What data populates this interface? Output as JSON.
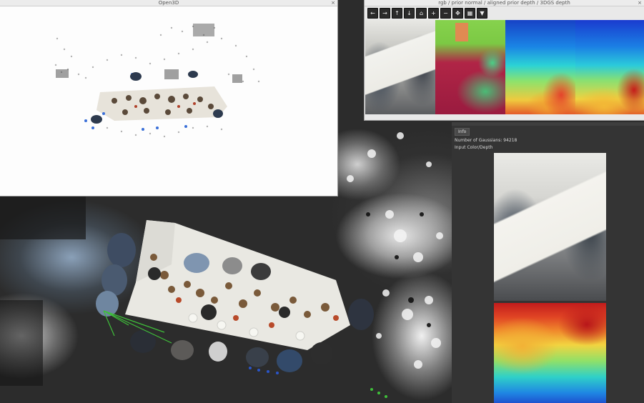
{
  "open3d_window": {
    "title": "Open3D",
    "close_glyph": "×"
  },
  "image_window": {
    "title": "rgb / prior normal / aligned prior depth / 3DGS depth",
    "close_glyph": "×",
    "toolbar_icons": [
      "arrow-left-icon",
      "arrow-right-icon",
      "arrow-up-icon",
      "arrow-down-icon",
      "home-icon",
      "zoom-in-icon",
      "zoom-out-icon",
      "pan-icon",
      "grid-icon",
      "save-icon"
    ],
    "toolbar_glyphs": [
      "←",
      "→",
      "↑",
      "↓",
      "⌂",
      "+",
      "−",
      "✥",
      "▦",
      "▼"
    ]
  },
  "gui_panel": {
    "tab_label": "Info",
    "gaussians_text": "Number of Gaussians: 94218",
    "input_label": "Input Color/Depth"
  }
}
